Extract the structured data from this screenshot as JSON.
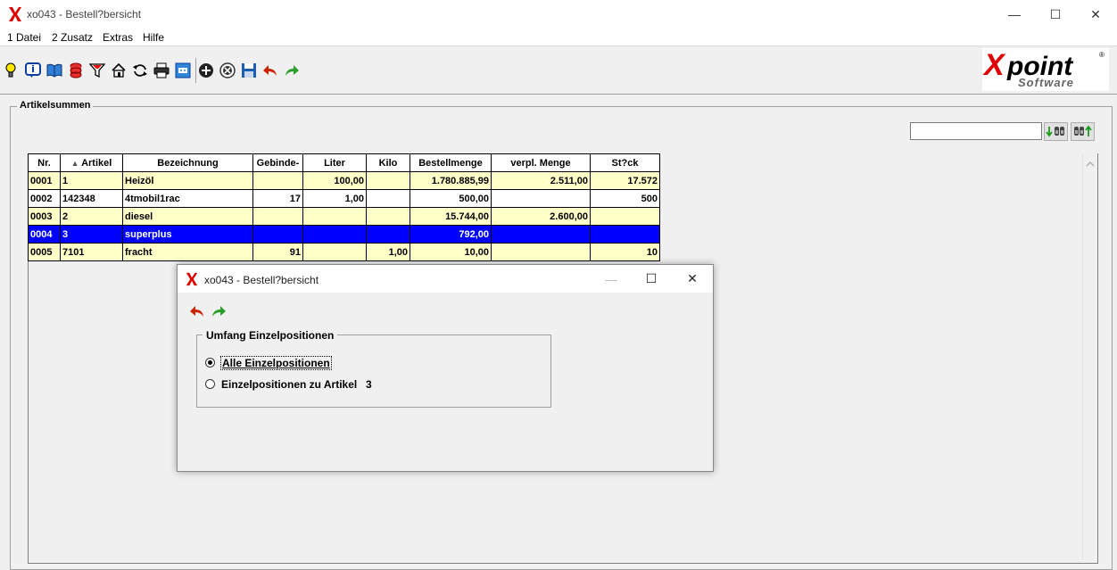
{
  "window": {
    "title": "xo043 - Bestell?bersicht",
    "minimize": "—",
    "maximize": "☐",
    "close": "✕"
  },
  "menu": {
    "items": [
      "1 Datei",
      "2 Zusatz",
      "Extras",
      "Hilfe"
    ]
  },
  "toolbar": {
    "icons": [
      "lightbulb-icon",
      "info-icon",
      "book-icon",
      "database-icon",
      "filter-icon",
      "home-icon",
      "refresh-icon",
      "print-icon",
      "window-icon",
      "add-icon",
      "cancel-icon",
      "save-icon",
      "undo-icon",
      "redo-icon"
    ]
  },
  "logo": {
    "brand": "Xpoint",
    "sub": "Software",
    "reg": "®"
  },
  "group": {
    "title": "Artikelsummen"
  },
  "search": {
    "value": ""
  },
  "table": {
    "columns": [
      "Nr.",
      "Artikel",
      "Bezeichnung",
      "Gebinde-",
      "Liter",
      "Kilo",
      "Bestellmenge",
      "verpl. Menge",
      "St?ck"
    ],
    "rows": [
      {
        "nr": "0001",
        "artikel": "1",
        "bez": "Heizöl",
        "gebinde": "",
        "liter": "100,00",
        "kilo": "",
        "bestell": "1.780.885,99",
        "verpl": "2.511,00",
        "stueck": "17.572",
        "style": "yellow"
      },
      {
        "nr": "0002",
        "artikel": "142348",
        "bez": "4tmobil1rac",
        "gebinde": "17",
        "liter": "1,00",
        "kilo": "",
        "bestell": "500,00",
        "verpl": "",
        "stueck": "500",
        "style": "white"
      },
      {
        "nr": "0003",
        "artikel": "2",
        "bez": "diesel",
        "gebinde": "",
        "liter": "",
        "kilo": "",
        "bestell": "15.744,00",
        "verpl": "2.600,00",
        "stueck": "",
        "style": "yellow"
      },
      {
        "nr": "0004",
        "artikel": "3",
        "bez": "superplus",
        "gebinde": "",
        "liter": "",
        "kilo": "",
        "bestell": "792,00",
        "verpl": "",
        "stueck": "",
        "style": "sel"
      },
      {
        "nr": "0005",
        "artikel": "7101",
        "bez": "fracht",
        "gebinde": "91",
        "liter": "",
        "kilo": "1,00",
        "bestell": "10,00",
        "verpl": "",
        "stueck": "10",
        "style": "yellow"
      }
    ]
  },
  "dialog": {
    "title": "xo043 - Bestell?bersicht",
    "minimize": "—",
    "maximize": "☐",
    "close": "✕",
    "group_title": "Umfang Einzelpositionen",
    "option_all": "Alle Einzelpositionen",
    "option_article": "Einzelpositionen zu Artikel",
    "article_value": "3",
    "selected": "all"
  },
  "colors": {
    "row_yellow": "#ffffc8",
    "row_selected": "#0000ff",
    "undo": "#cc2200",
    "redo": "#2a9d2a",
    "logo_red": "#e00000"
  }
}
